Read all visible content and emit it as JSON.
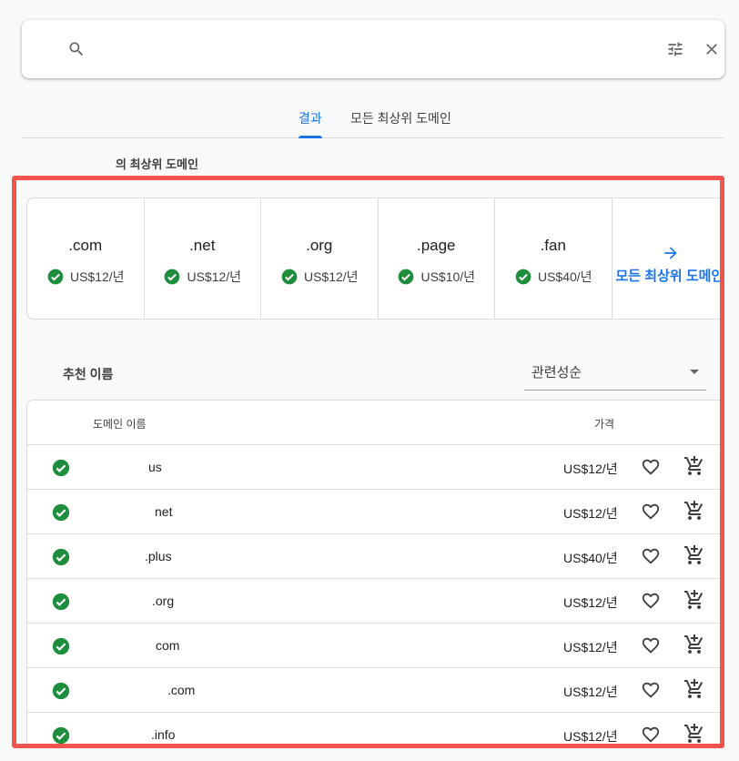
{
  "search": {
    "value": "",
    "placeholder": ""
  },
  "tabs": [
    {
      "label": "결과",
      "active": true
    },
    {
      "label": "모든 최상위 도메인",
      "active": false
    }
  ],
  "section_label": "의 최상위 도메인",
  "tld_cards": [
    {
      "name": ".com",
      "price": "US$12/년"
    },
    {
      "name": ".net",
      "price": "US$12/년"
    },
    {
      "name": ".org",
      "price": "US$12/년"
    },
    {
      "name": ".page",
      "price": "US$10/년"
    },
    {
      "name": ".fan",
      "price": "US$40/년"
    }
  ],
  "all_tlds_link": "모든 최상위 도메인",
  "suggestions": {
    "title": "추천 이름",
    "sort": {
      "selected": "관련성순"
    },
    "columns": {
      "name": "도메인 이름",
      "price": "가격"
    },
    "rows": [
      {
        "name": "us",
        "price": "US$12/년"
      },
      {
        "name": "net",
        "price": "US$12/년"
      },
      {
        "name": ".plus",
        "price": "US$40/년"
      },
      {
        "name": ".org",
        "price": "US$12/년"
      },
      {
        "name": "com",
        "price": "US$12/년"
      },
      {
        "name": ".com",
        "price": "US$12/년"
      },
      {
        "name": ".info",
        "price": "US$12/년"
      }
    ]
  },
  "colors": {
    "accent": "#1a73e8",
    "available_green": "#1e8e3e",
    "highlight_border": "#f2544b"
  },
  "icons": [
    "search-icon",
    "tune-icon",
    "close-icon",
    "check-circle-icon",
    "arrow-right-icon",
    "heart-outline-icon",
    "add-to-cart-icon",
    "dropdown-caret-icon"
  ]
}
